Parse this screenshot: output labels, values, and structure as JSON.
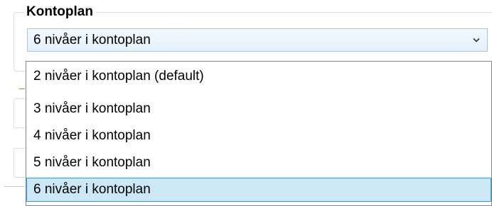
{
  "groupbox": {
    "title": "Kontoplan"
  },
  "combo": {
    "value": "6 nivåer i kontoplan",
    "arrow_icon": "chevron-down-icon"
  },
  "dropdown": {
    "options": [
      {
        "label": "2 nivåer i kontoplan (default)",
        "selected": false
      },
      {
        "label": "3 nivåer i kontoplan",
        "selected": false
      },
      {
        "label": "4 nivåer i kontoplan",
        "selected": false
      },
      {
        "label": "5 nivåer i kontoplan",
        "selected": false
      },
      {
        "label": "6 nivåer i kontoplan",
        "selected": true
      }
    ]
  },
  "colors": {
    "selection_fill": "#cce8f7",
    "selection_border": "#26a0da",
    "combo_border": "#a9c4de"
  }
}
